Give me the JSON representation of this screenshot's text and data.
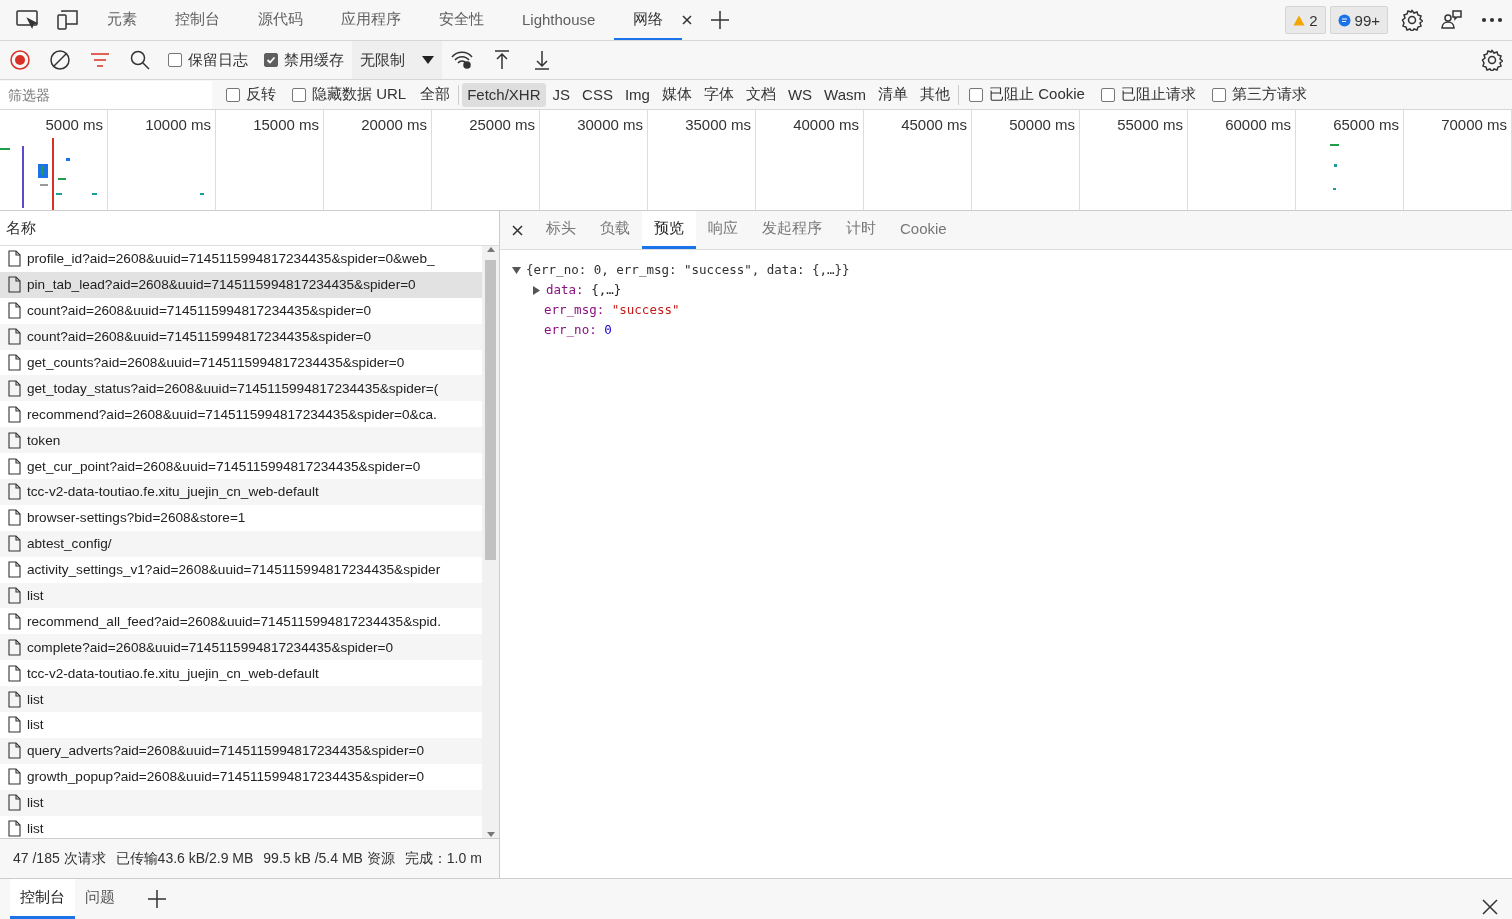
{
  "main_tabs": [
    {
      "label": "元素",
      "selected": false
    },
    {
      "label": "控制台",
      "selected": false
    },
    {
      "label": "源代码",
      "selected": false
    },
    {
      "label": "应用程序",
      "selected": false
    },
    {
      "label": "安全性",
      "selected": false
    },
    {
      "label": "Lighthouse",
      "selected": false
    },
    {
      "label": "网络",
      "selected": true,
      "closable": true
    }
  ],
  "badges": [
    {
      "kind": "warning",
      "count": "2"
    },
    {
      "kind": "message",
      "count": "99+"
    }
  ],
  "toolbar": {
    "recording": true,
    "preserve_log": {
      "label": "保留日志",
      "checked": false
    },
    "disable_cache": {
      "label": "禁用缓存",
      "checked": true
    },
    "throttling": "无限制"
  },
  "filter": {
    "placeholder": "筛选器",
    "invert": {
      "label": "反转",
      "checked": false
    },
    "hide_data_urls": {
      "label": "隐藏数据 URL",
      "checked": false
    },
    "types": [
      {
        "label": "全部",
        "selected": false
      },
      {
        "label": "Fetch/XHR",
        "selected": true
      },
      {
        "label": "JS",
        "selected": false
      },
      {
        "label": "CSS",
        "selected": false
      },
      {
        "label": "Img",
        "selected": false
      },
      {
        "label": "媒体",
        "selected": false
      },
      {
        "label": "字体",
        "selected": false
      },
      {
        "label": "文档",
        "selected": false
      },
      {
        "label": "WS",
        "selected": false
      },
      {
        "label": "Wasm",
        "selected": false
      },
      {
        "label": "清单",
        "selected": false
      },
      {
        "label": "其他",
        "selected": false
      }
    ],
    "options": [
      {
        "label": "已阻止 Cookie",
        "checked": false
      },
      {
        "label": "已阻止请求",
        "checked": false
      },
      {
        "label": "第三方请求",
        "checked": false
      }
    ]
  },
  "timeline": {
    "ticks": [
      "5000 ms",
      "10000 ms",
      "15000 ms",
      "20000 ms",
      "25000 ms",
      "30000 ms",
      "35000 ms",
      "40000 ms",
      "45000 ms",
      "50000 ms",
      "55000 ms",
      "60000 ms",
      "65000 ms",
      "70000 ms"
    ]
  },
  "requests": {
    "column": "名称",
    "rows": [
      {
        "name": "profile_id?aid=2608&uuid=7145115994817234435&spider=0&web_",
        "selected": false
      },
      {
        "name": "pin_tab_lead?aid=2608&uuid=7145115994817234435&spider=0",
        "selected": true
      },
      {
        "name": "count?aid=2608&uuid=7145115994817234435&spider=0",
        "selected": false
      },
      {
        "name": "count?aid=2608&uuid=7145115994817234435&spider=0",
        "selected": false
      },
      {
        "name": "get_counts?aid=2608&uuid=7145115994817234435&spider=0",
        "selected": false
      },
      {
        "name": "get_today_status?aid=2608&uuid=7145115994817234435&spider=(",
        "selected": false
      },
      {
        "name": "recommend?aid=2608&uuid=7145115994817234435&spider=0&ca.",
        "selected": false
      },
      {
        "name": "token",
        "selected": false
      },
      {
        "name": "get_cur_point?aid=2608&uuid=7145115994817234435&spider=0",
        "selected": false
      },
      {
        "name": "tcc-v2-data-toutiao.fe.xitu_juejin_cn_web-default",
        "selected": false
      },
      {
        "name": "browser-settings?bid=2608&store=1",
        "selected": false
      },
      {
        "name": "abtest_config/",
        "selected": false
      },
      {
        "name": "activity_settings_v1?aid=2608&uuid=7145115994817234435&spider",
        "selected": false
      },
      {
        "name": "list",
        "selected": false
      },
      {
        "name": "recommend_all_feed?aid=2608&uuid=7145115994817234435&spid.",
        "selected": false
      },
      {
        "name": "complete?aid=2608&uuid=7145115994817234435&spider=0",
        "selected": false
      },
      {
        "name": "tcc-v2-data-toutiao.fe.xitu_juejin_cn_web-default",
        "selected": false
      },
      {
        "name": "list",
        "selected": false
      },
      {
        "name": "list",
        "selected": false
      },
      {
        "name": "query_adverts?aid=2608&uuid=7145115994817234435&spider=0",
        "selected": false
      },
      {
        "name": "growth_popup?aid=2608&uuid=7145115994817234435&spider=0",
        "selected": false
      },
      {
        "name": "list",
        "selected": false
      },
      {
        "name": "list",
        "selected": false
      }
    ]
  },
  "status_bar": [
    "47 /185 次请求",
    "已传输43.6 kB/2.9 MB",
    "99.5 kB /5.4 MB 资源",
    "完成：1.0 m"
  ],
  "detail_tabs": [
    {
      "label": "标头",
      "selected": false
    },
    {
      "label": "负载",
      "selected": false
    },
    {
      "label": "预览",
      "selected": true
    },
    {
      "label": "响应",
      "selected": false
    },
    {
      "label": "发起程序",
      "selected": false
    },
    {
      "label": "计时",
      "selected": false
    },
    {
      "label": "Cookie",
      "selected": false
    }
  ],
  "preview": {
    "summary": "{err_no: 0, err_msg: \"success\", data: {,…}}",
    "expanded": true,
    "properties": [
      {
        "key": "data:",
        "value": "{,…}",
        "kind": "object",
        "expanded": false
      },
      {
        "key": "err_msg:",
        "value": "\"success\"",
        "kind": "string"
      },
      {
        "key": "err_no:",
        "value": "0",
        "kind": "number"
      }
    ]
  },
  "drawer_tabs": [
    {
      "label": "控制台",
      "selected": true
    },
    {
      "label": "问题",
      "selected": false
    }
  ]
}
